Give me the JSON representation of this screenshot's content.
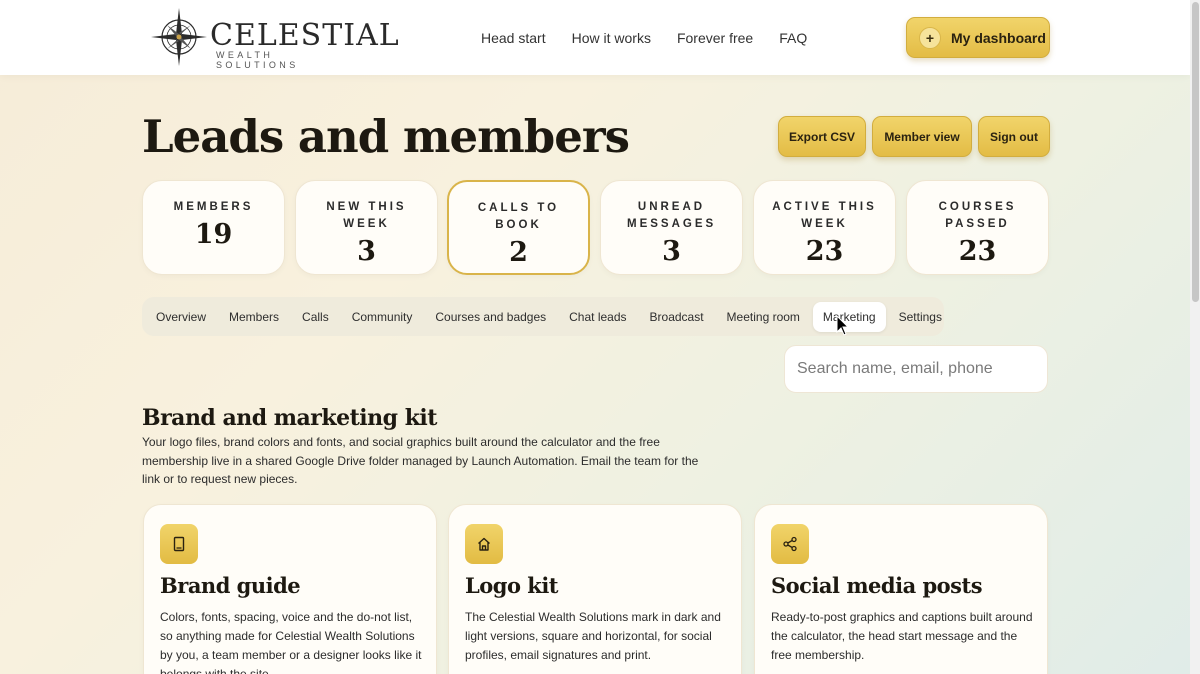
{
  "brand": {
    "name": "CELESTIAL",
    "sub": "WEALTH SOLUTIONS"
  },
  "nav": [
    {
      "label": "Head start"
    },
    {
      "label": "How it works"
    },
    {
      "label": "Forever free"
    },
    {
      "label": "FAQ"
    }
  ],
  "dashboard_button": {
    "label": "My dashboard",
    "icon": "+"
  },
  "page_title": "Leads and members",
  "header_buttons": {
    "export": "Export CSV",
    "member_view": "Member view",
    "sign_out": "Sign out"
  },
  "stats": [
    {
      "label": "MEMBERS",
      "value": "19"
    },
    {
      "label": "NEW THIS WEEK",
      "value": "3"
    },
    {
      "label": "CALLS TO BOOK",
      "value": "2"
    },
    {
      "label": "UNREAD MESSAGES",
      "value": "3"
    },
    {
      "label": "ACTIVE THIS WEEK",
      "value": "23"
    },
    {
      "label": "COURSES PASSED",
      "value": "23"
    }
  ],
  "tabs": [
    {
      "label": "Overview"
    },
    {
      "label": "Members"
    },
    {
      "label": "Calls"
    },
    {
      "label": "Community"
    },
    {
      "label": "Courses and badges"
    },
    {
      "label": "Chat leads"
    },
    {
      "label": "Broadcast"
    },
    {
      "label": "Meeting room"
    },
    {
      "label": "Marketing"
    },
    {
      "label": "Settings"
    }
  ],
  "active_tab": "Marketing",
  "search": {
    "placeholder": "Search name, email, phone",
    "value": ""
  },
  "section": {
    "title": "Brand and marketing kit",
    "description": "Your logo files, brand colors and fonts, and social graphics built around the calculator and the free membership live in a shared Google Drive folder managed by Launch Automation. Email the team for the link or to request new pieces."
  },
  "cards": [
    {
      "title": "Brand guide",
      "icon": "book-icon",
      "desc": "Colors, fonts, spacing, voice and the do-not list, so anything made for Celestial Wealth Solutions by you, a team member or a designer looks like it belongs with the site."
    },
    {
      "title": "Logo kit",
      "icon": "home-icon",
      "desc": "The Celestial Wealth Solutions mark in dark and light versions, square and horizontal, for social profiles, email signatures and print."
    },
    {
      "title": "Social media posts",
      "icon": "share-icon",
      "desc": "Ready-to-post graphics and captions built around the calculator, the head start message and the free membership."
    }
  ],
  "colors": {
    "accent_gold": "#e3bc45",
    "active_border": "#d9b44a",
    "text": "#1d1911"
  }
}
